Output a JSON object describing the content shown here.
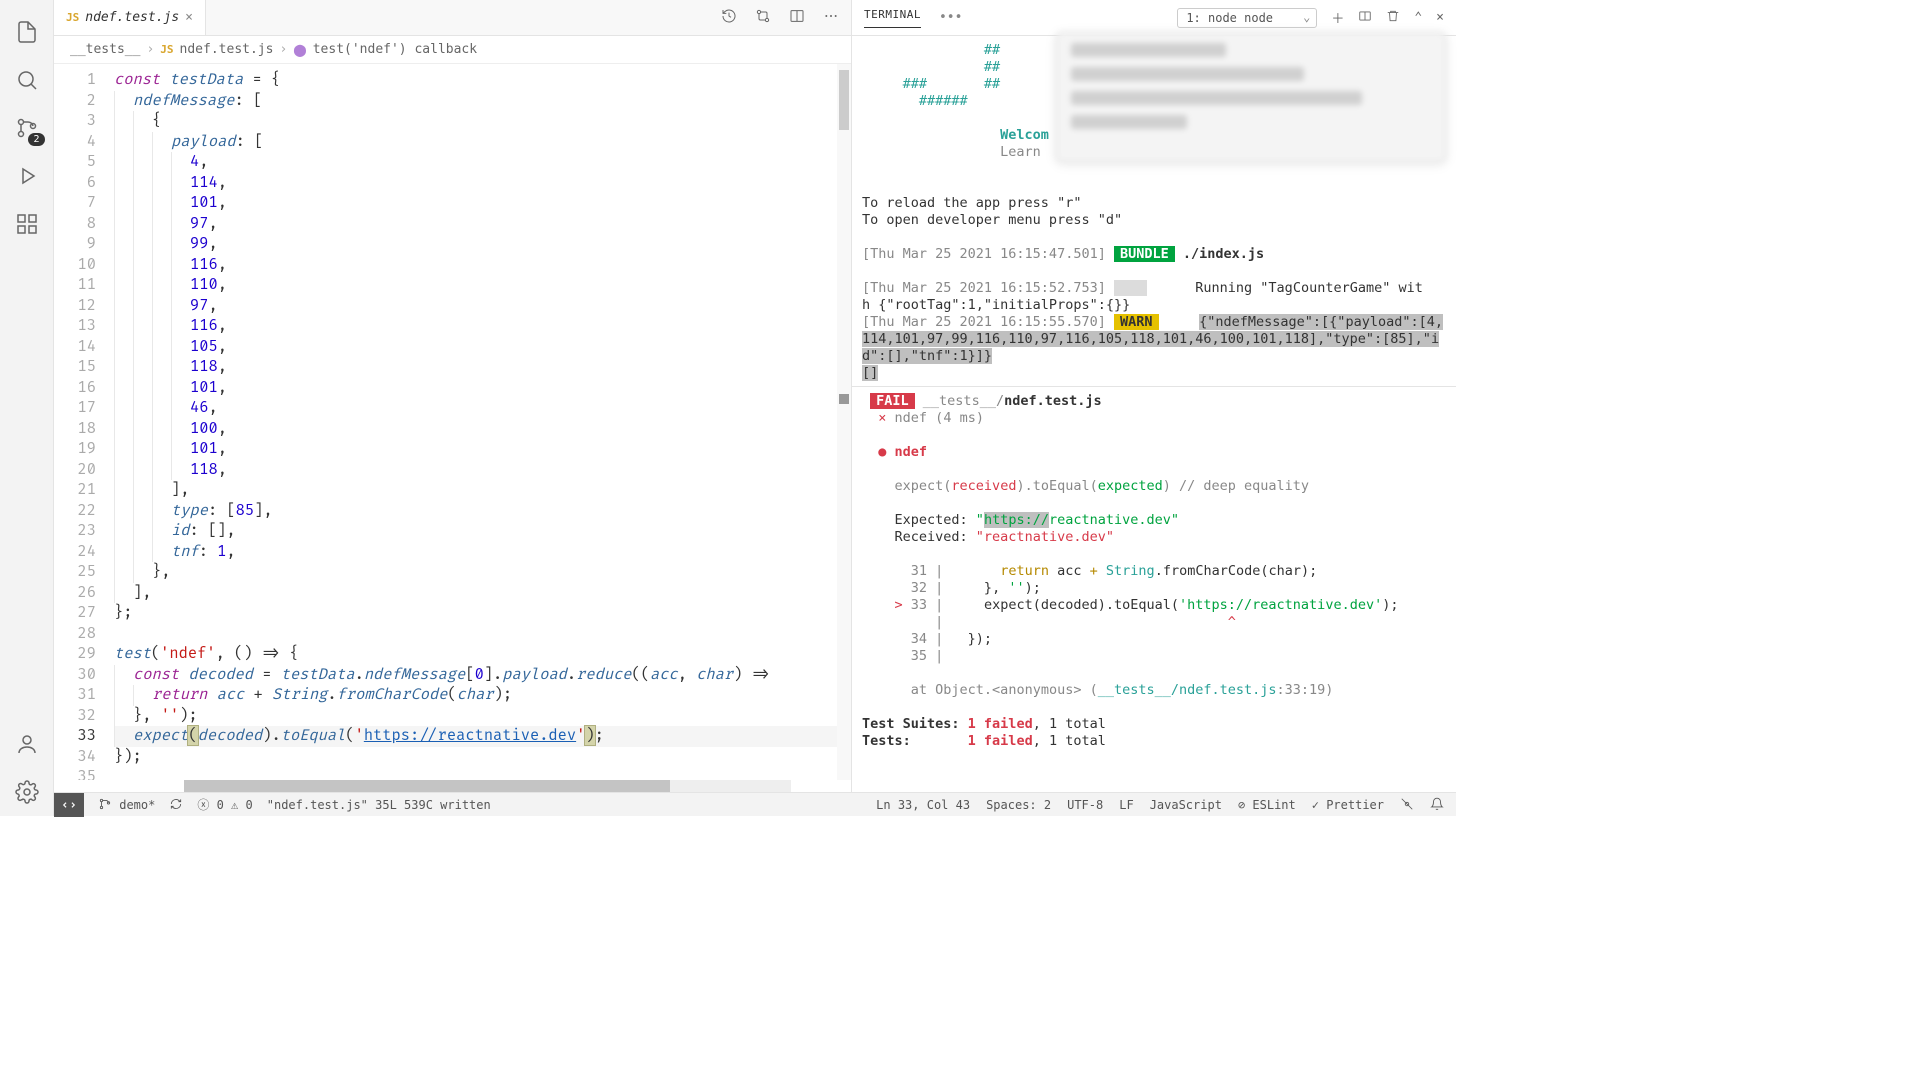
{
  "tab": {
    "filename": "ndef.test.js",
    "lang_badge": "JS"
  },
  "breadcrumb": {
    "folder": "__tests__",
    "file": "ndef.test.js",
    "symbol": "test('ndef') callback"
  },
  "scm_badge": "2",
  "code_lines": [
    "const testData = {",
    "  ndefMessage: [",
    "    {",
    "      payload: [",
    "        4,",
    "        114,",
    "        101,",
    "        97,",
    "        99,",
    "        116,",
    "        110,",
    "        97,",
    "        116,",
    "        105,",
    "        118,",
    "        101,",
    "        46,",
    "        100,",
    "        101,",
    "        118,",
    "      ],",
    "      type: [85],",
    "      id: [],",
    "      tnf: 1,",
    "    },",
    "  ],",
    "};",
    "",
    "test('ndef', () => {",
    "  const decoded = testData.ndefMessage[0].payload.reduce((acc, char) =>",
    "    return acc + String.fromCharCode(char);",
    "  }, '');",
    "  expect(decoded).toEqual('https://reactnative.dev');",
    "});",
    ""
  ],
  "current_line": 33,
  "terminal": {
    "tab_label": "TERMINAL",
    "shell_label": "1: node  node",
    "hash_art": [
      "               ##",
      "               ##",
      "     ###       ##        ##",
      "       ######"
    ],
    "welcome": "Welcom",
    "learn": "Learn ",
    "reload_hint": "To reload the app press \"r\"",
    "devmenu_hint": "To open developer menu press \"d\"",
    "bundle": {
      "ts": "[Thu Mar 25 2021 16:15:47.501]",
      "label": "BUNDLE",
      "path": "./index.js"
    },
    "run": {
      "ts": "[Thu Mar 25 2021 16:15:52.753]",
      "text1": "Running \"TagCounterGame\" wit",
      "text2": "h {\"rootTag\":1,\"initialProps\":{}}"
    },
    "warn": {
      "ts": "[Thu Mar 25 2021 16:15:55.570]",
      "label": "WARN",
      "payload": "{\"ndefMessage\":[{\"payload\":[4,114,101,97,99,116,110,97,116,105,118,101,46,100,101,118],\"type\":[85],\"id\":[],\"tnf\":1}]}"
    },
    "fail": {
      "label": "FAIL",
      "path_dim": "__tests__/",
      "path_bold": "ndef.test.js",
      "x_line": "ndef (4 ms)",
      "suite_name": "ndef",
      "expect_line_pre": "expect(",
      "expect_received": "received",
      "expect_mid": ").toEqual(",
      "expect_expected": "expected",
      "expect_post": ") // deep equality",
      "expected_label": "Expected: ",
      "expected_val": "\"https://reactnative.dev\"",
      "expected_hl": "https://",
      "expected_rest": "reactnative.dev\"",
      "received_label": "Received: ",
      "received_val": "\"reactnative.dev\"",
      "ctx": [
        {
          "n": "31",
          "t": "      return acc + String.fromCharCode(char);"
        },
        {
          "n": "32",
          "t": "    }, '');"
        },
        {
          "n": "33",
          "t": "    expect(decoded).toEqual('https://reactnative.dev');",
          "ptr": true
        },
        {
          "n": "",
          "t": "                                  ^"
        },
        {
          "n": "34",
          "t": "  });"
        },
        {
          "n": "35",
          "t": ""
        }
      ],
      "at": "at Object.<anonymous> (",
      "at_path": "__tests__/ndef.test.js",
      "at_loc": ":33:19)",
      "suites_label": "Test Suites: ",
      "suites_fail": "1 failed",
      "suites_rest": ", 1 total",
      "tests_label": "Tests:       ",
      "tests_fail": "1 failed",
      "tests_rest": ", 1 total"
    }
  },
  "statusbar": {
    "branch": "demo*",
    "errors": "0",
    "warnings": "0",
    "write_msg": "\"ndef.test.js\" 35L 539C written",
    "cursor": "Ln 33, Col 43",
    "spaces": "Spaces: 2",
    "enc": "UTF-8",
    "eol": "LF",
    "lang": "JavaScript",
    "eslint": "ESLint",
    "prettier": "Prettier"
  }
}
